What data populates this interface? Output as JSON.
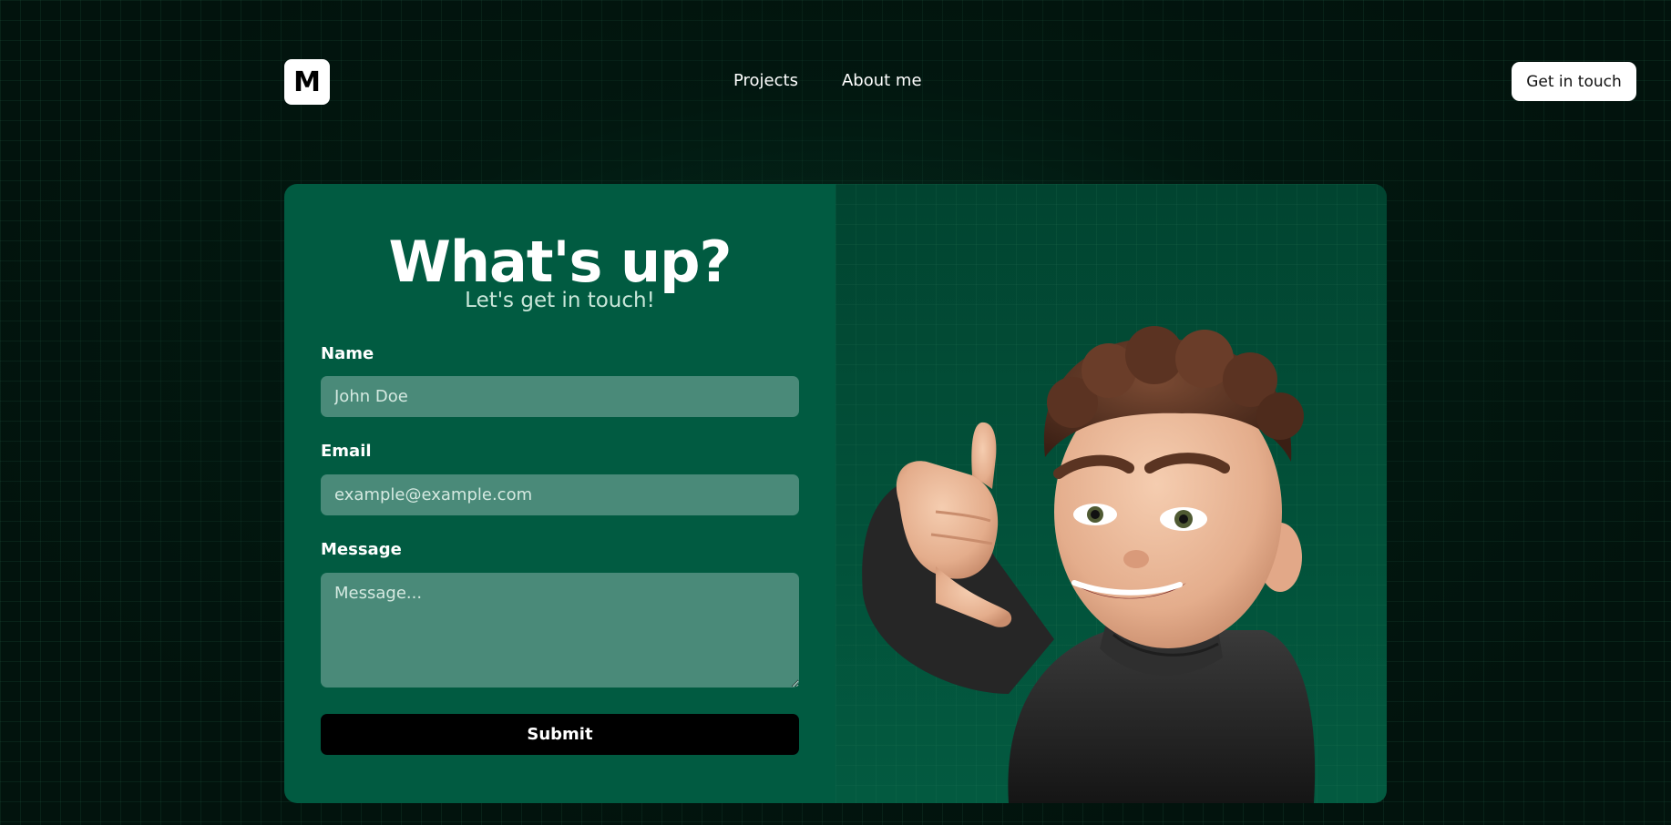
{
  "header": {
    "logo_text": "M",
    "nav": [
      {
        "label": "Projects"
      },
      {
        "label": "About me"
      }
    ],
    "cta_label": "Get in touch"
  },
  "contact": {
    "title": "What's up?",
    "subtitle": "Let's get in touch!",
    "name": {
      "label": "Name",
      "placeholder": "John Doe",
      "value": ""
    },
    "email": {
      "label": "Email",
      "placeholder": "example@example.com",
      "value": ""
    },
    "message": {
      "label": "Message",
      "placeholder": "Message...",
      "value": ""
    },
    "submit_label": "Submit"
  },
  "colors": {
    "page_bg": "#02130d",
    "card_left": "#015b41",
    "input_bg": "#4a8a79",
    "button_bg": "#000000"
  }
}
